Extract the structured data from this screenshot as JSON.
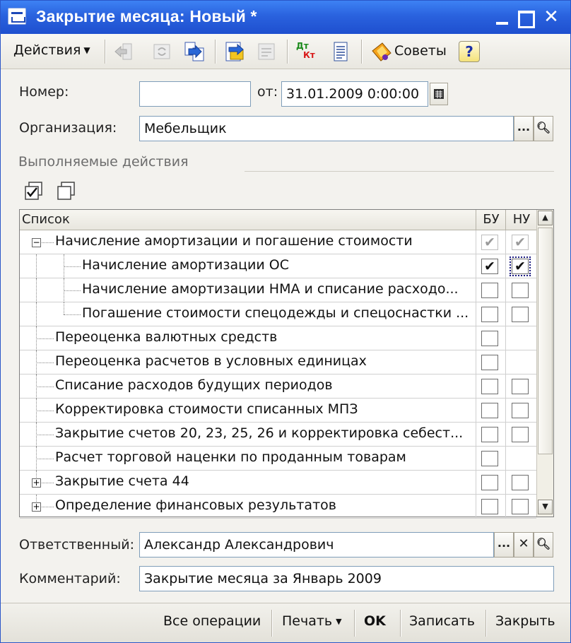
{
  "window": {
    "title": "Закрытие месяца: Новый *"
  },
  "toolbar": {
    "actions_label": "Действия",
    "advice_label": "Советы",
    "help_label": "?",
    "dtkt_icon_text_top": "Дт",
    "dtkt_icon_text_bottom": "Кт"
  },
  "form": {
    "number_label": "Номер:",
    "number_value": "",
    "date_label": "от:",
    "date_value": "31.01.2009  0:00:00",
    "org_label": "Организация:",
    "org_value": "Мебельщик",
    "section_title": "Выполняемые действия",
    "select_button": "...",
    "responsible_label": "Ответственный:",
    "responsible_value": "Александр Александрович",
    "comment_label": "Комментарий:",
    "comment_value": "Закрытие месяца за Январь 2009"
  },
  "table": {
    "columns": [
      "Список",
      "БУ",
      "НУ"
    ],
    "rows": [
      {
        "text": "Начисление амортизации и погашение стоимости",
        "level": 0,
        "expander": "minus",
        "bu": "checked-disabled",
        "nu": "checked-disabled"
      },
      {
        "text": "Начисление амортизации ОС",
        "level": 1,
        "expander": "none",
        "bu": "checked",
        "nu": "checked-focus"
      },
      {
        "text": "Начисление амортизации НМА и списание расходо...",
        "level": 1,
        "expander": "none",
        "bu": "unchecked",
        "nu": "unchecked"
      },
      {
        "text": "Погашение стоимости спецодежды и спецоснастки ...",
        "level": 1,
        "expander": "none",
        "bu": "unchecked",
        "nu": "unchecked"
      },
      {
        "text": "Переоценка валютных средств",
        "level": 0,
        "expander": "none",
        "bu": "unchecked",
        "nu": "none"
      },
      {
        "text": "Переоценка расчетов в условных единицах",
        "level": 0,
        "expander": "none",
        "bu": "unchecked",
        "nu": "none"
      },
      {
        "text": "Списание расходов будущих периодов",
        "level": 0,
        "expander": "none",
        "bu": "unchecked",
        "nu": "unchecked"
      },
      {
        "text": "Корректировка стоимости списанных МПЗ",
        "level": 0,
        "expander": "none",
        "bu": "unchecked",
        "nu": "unchecked"
      },
      {
        "text": "Закрытие счетов 20, 23, 25, 26 и корректировка себест...",
        "level": 0,
        "expander": "none",
        "bu": "unchecked",
        "nu": "unchecked"
      },
      {
        "text": "Расчет торговой наценки по проданным товарам",
        "level": 0,
        "expander": "none",
        "bu": "unchecked",
        "nu": "none"
      },
      {
        "text": "Закрытие счета 44",
        "level": 0,
        "expander": "plus",
        "bu": "unchecked",
        "nu": "unchecked"
      },
      {
        "text": "Определение финансовых результатов",
        "level": 0,
        "expander": "plus",
        "bu": "unchecked",
        "nu": "unchecked"
      }
    ]
  },
  "bottom": {
    "all_operations": "Все операции",
    "print": "Печать",
    "ok": "OK",
    "save": "Записать",
    "close": "Закрыть"
  },
  "colors": {
    "titlebar": "#2a62de",
    "window_bg": "#f3f2ee",
    "field_border": "#7f9db9"
  }
}
